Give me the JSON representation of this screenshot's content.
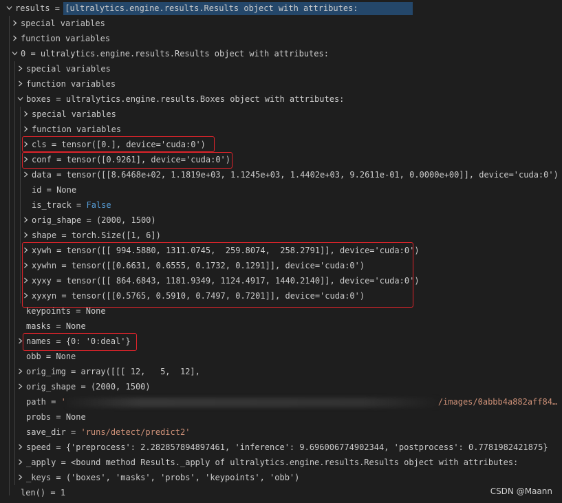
{
  "tree": [
    {
      "key": "results",
      "eq": " = ",
      "val": "[ultralytics.engine.results.Results object with attributes:",
      "chev": "down",
      "indent": 0
    },
    {
      "key": "special variables",
      "chev": "right",
      "indent": 1
    },
    {
      "key": "function variables",
      "chev": "right",
      "indent": 1
    },
    {
      "key": "0",
      "eq": " = ",
      "val": "ultralytics.engine.results.Results object with attributes:",
      "chev": "down",
      "indent": 1
    },
    {
      "key": "special variables",
      "chev": "right",
      "indent": 2
    },
    {
      "key": "function variables",
      "chev": "right",
      "indent": 2
    },
    {
      "key": "boxes",
      "eq": " = ",
      "val": "ultralytics.engine.results.Boxes object with attributes:",
      "chev": "down",
      "indent": 2
    },
    {
      "key": "special variables",
      "chev": "right",
      "indent": 3
    },
    {
      "key": "function variables",
      "chev": "right",
      "indent": 3
    },
    {
      "key": "cls",
      "eq": " = ",
      "val": "tensor([0.], device='cuda:0')",
      "chev": "right",
      "indent": 3
    },
    {
      "key": "conf",
      "eq": " = ",
      "val": "tensor([0.9261], device='cuda:0')",
      "chev": "right",
      "indent": 3
    },
    {
      "key": "data",
      "eq": " = ",
      "val": "tensor([[8.6468e+02, 1.1819e+03, 1.1245e+03, 1.4402e+03, 9.2611e-01, 0.0000e+00]], device='cuda:0')",
      "chev": "right",
      "indent": 3
    },
    {
      "key": "id",
      "eq": " = ",
      "val": "None",
      "chev": "none",
      "indent": 3
    },
    {
      "key": "is_track",
      "eq": " = ",
      "val": "False",
      "valclass": "kw",
      "chev": "none",
      "indent": 3
    },
    {
      "key": "orig_shape",
      "eq": " = ",
      "val": "(2000, 1500)",
      "chev": "right",
      "indent": 3
    },
    {
      "key": "shape",
      "eq": " = ",
      "val": "torch.Size([1, 6])",
      "chev": "right",
      "indent": 3
    },
    {
      "key": "xywh",
      "eq": " = ",
      "val": "tensor([[ 994.5880, 1311.0745,  259.8074,  258.2791]], device='cuda:0')",
      "chev": "right",
      "indent": 3
    },
    {
      "key": "xywhn",
      "eq": " = ",
      "val": "tensor([[0.6631, 0.6555, 0.1732, 0.1291]], device='cuda:0')",
      "chev": "right",
      "indent": 3
    },
    {
      "key": "xyxy",
      "eq": " = ",
      "val": "tensor([[ 864.6843, 1181.9349, 1124.4917, 1440.2140]], device='cuda:0')",
      "chev": "right",
      "indent": 3
    },
    {
      "key": "xyxyn",
      "eq": " = ",
      "val": "tensor([[0.5765, 0.5910, 0.7497, 0.7201]], device='cuda:0')",
      "chev": "right",
      "indent": 3
    },
    {
      "key": "keypoints",
      "eq": " = ",
      "val": "None",
      "chev": "none",
      "indent": 2
    },
    {
      "key": "masks",
      "eq": " = ",
      "val": "None",
      "chev": "none",
      "indent": 2
    },
    {
      "key": "names",
      "eq": " = ",
      "val": "{0: '0:deal'}",
      "chev": "right",
      "indent": 2
    },
    {
      "key": "obb",
      "eq": " = ",
      "val": "None",
      "chev": "none",
      "indent": 2
    },
    {
      "key": "orig_img",
      "eq": " = ",
      "val": "array([[[ 12,   5,  12],",
      "chev": "right",
      "indent": 2
    },
    {
      "key": "orig_shape",
      "eq": " = ",
      "val": "(2000, 1500)",
      "chev": "right",
      "indent": 2
    },
    {
      "key": "path",
      "eq": " = ",
      "val": "'",
      "val2": "/images/0abbb4a882aff84…",
      "valclass": "str",
      "chev": "none",
      "indent": 2
    },
    {
      "key": "probs",
      "eq": " = ",
      "val": "None",
      "chev": "none",
      "indent": 2
    },
    {
      "key": "save_dir",
      "eq": " = ",
      "val": "'runs/detect/predict2'",
      "valclass": "str",
      "chev": "none",
      "indent": 2
    },
    {
      "key": "speed",
      "eq": " = ",
      "val": "{'preprocess': 2.282857894897461, 'inference': 9.696006774902344, 'postprocess': 0.7781982421875}",
      "chev": "right",
      "indent": 2
    },
    {
      "key": "_apply",
      "eq": " = ",
      "val": "<bound method Results._apply of ultralytics.engine.results.Results object with attributes:",
      "chev": "right",
      "indent": 2
    },
    {
      "key": "_keys",
      "eq": " = ",
      "val": "('boxes', 'masks', 'probs', 'keypoints', 'obb')",
      "chev": "right",
      "indent": 2
    },
    {
      "key": "len()",
      "eq": " = ",
      "val": "1",
      "chev": "none",
      "indent": 1
    }
  ],
  "watermark": "CSDN @Maann",
  "colors": {
    "highlight_box": "#e0242b",
    "selection": "#264f78",
    "keyword": "#569cd6",
    "string": "#ce9178"
  }
}
